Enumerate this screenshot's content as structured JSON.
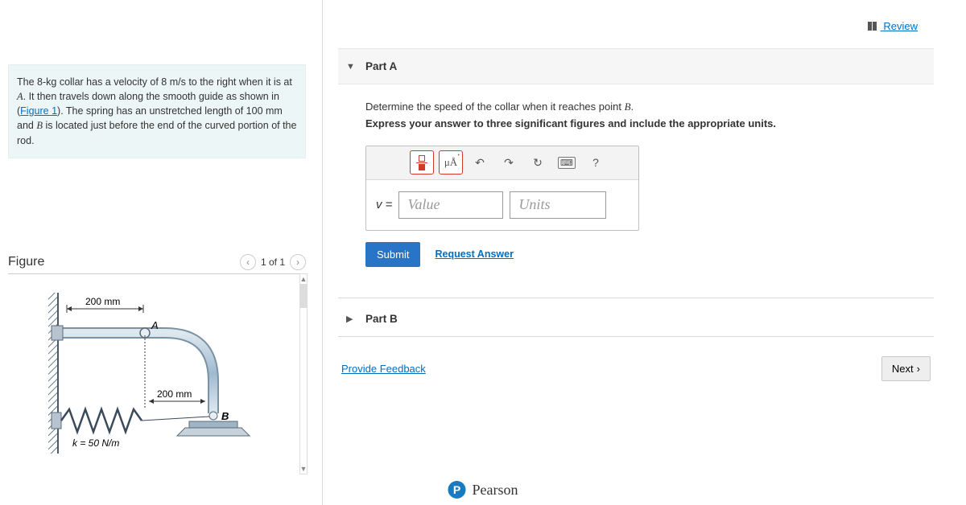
{
  "nav": {
    "review": "Review"
  },
  "problem": {
    "text_a": "The 8-",
    "kg": "kg",
    "text_b": " collar has a velocity of 8 ",
    "ms": "m/s",
    "text_c": " to the right when it is at ",
    "A": "A",
    "text_d": ". It then travels down along the smooth guide as shown in (",
    "figlink": "Figure 1",
    "text_e": "). The spring has an unstretched length of 100 ",
    "mm": "mm",
    "text_f": " and ",
    "B": "B",
    "text_g": " is located just before the end of the curved portion of the rod."
  },
  "figure": {
    "title": "Figure",
    "counter": "1 of 1",
    "dim1": "200 mm",
    "dim2": "200 mm",
    "ptA": "A",
    "ptB": "B",
    "k_label": "k = 50 N/m"
  },
  "partA": {
    "title": "Part A",
    "line1_a": "Determine the speed of the collar when it reaches point ",
    "line1_B": "B",
    "line1_b": ".",
    "line2": "Express your answer to three significant figures and include the appropriate units.",
    "var": "v =",
    "value_ph": "Value",
    "units_ph": "Units",
    "mua": "μÅ",
    "submit": "Submit",
    "request": "Request Answer",
    "undo": "↶",
    "redo": "↷",
    "reset": "↻",
    "kbd": "⌨",
    "help": "?"
  },
  "partB": {
    "title": "Part B"
  },
  "footer": {
    "feedback": "Provide Feedback",
    "next": "Next",
    "pearson": "Pearson",
    "p": "P"
  }
}
